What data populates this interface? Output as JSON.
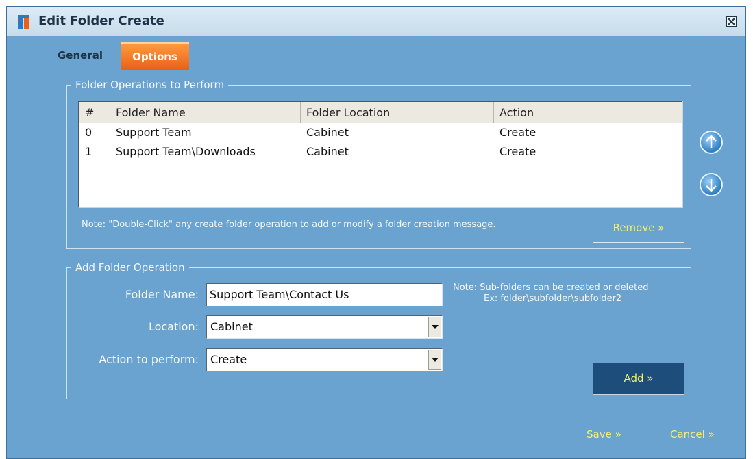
{
  "window": {
    "title": "Edit Folder Create",
    "close_icon": "close-icon"
  },
  "tabs": [
    {
      "label": "General",
      "active": false
    },
    {
      "label": "Options",
      "active": true
    }
  ],
  "operations": {
    "legend": "Folder Operations to Perform",
    "columns": [
      "#",
      "Folder Name",
      "Folder Location",
      "Action"
    ],
    "rows": [
      {
        "index": "0",
        "name": "Support Team",
        "location": "Cabinet",
        "action": "Create"
      },
      {
        "index": "1",
        "name": "Support Team\\Downloads",
        "location": "Cabinet",
        "action": "Create"
      }
    ],
    "note": "Note: \"Double-Click\" any create folder operation to add or modify a folder creation message.",
    "remove_label": "Remove »"
  },
  "add_operation": {
    "legend": "Add Folder Operation",
    "folder_name_label": "Folder Name:",
    "folder_name_value": "Support Team\\Contact Us",
    "location_label": "Location:",
    "location_value": "Cabinet",
    "action_label": "Action to perform:",
    "action_value": "Create",
    "note_line1": "Note: Sub-folders can be created or deleted",
    "note_line2": "Ex: folder\\subfolder\\subfolder2",
    "add_label": "Add »"
  },
  "footer": {
    "save_label": "Save »",
    "cancel_label": "Cancel »"
  },
  "colors": {
    "panel": "#6aa3cf",
    "accent_tab": "#e9611a",
    "link": "#f6ee6e",
    "dark_button": "#1d4e7b"
  }
}
